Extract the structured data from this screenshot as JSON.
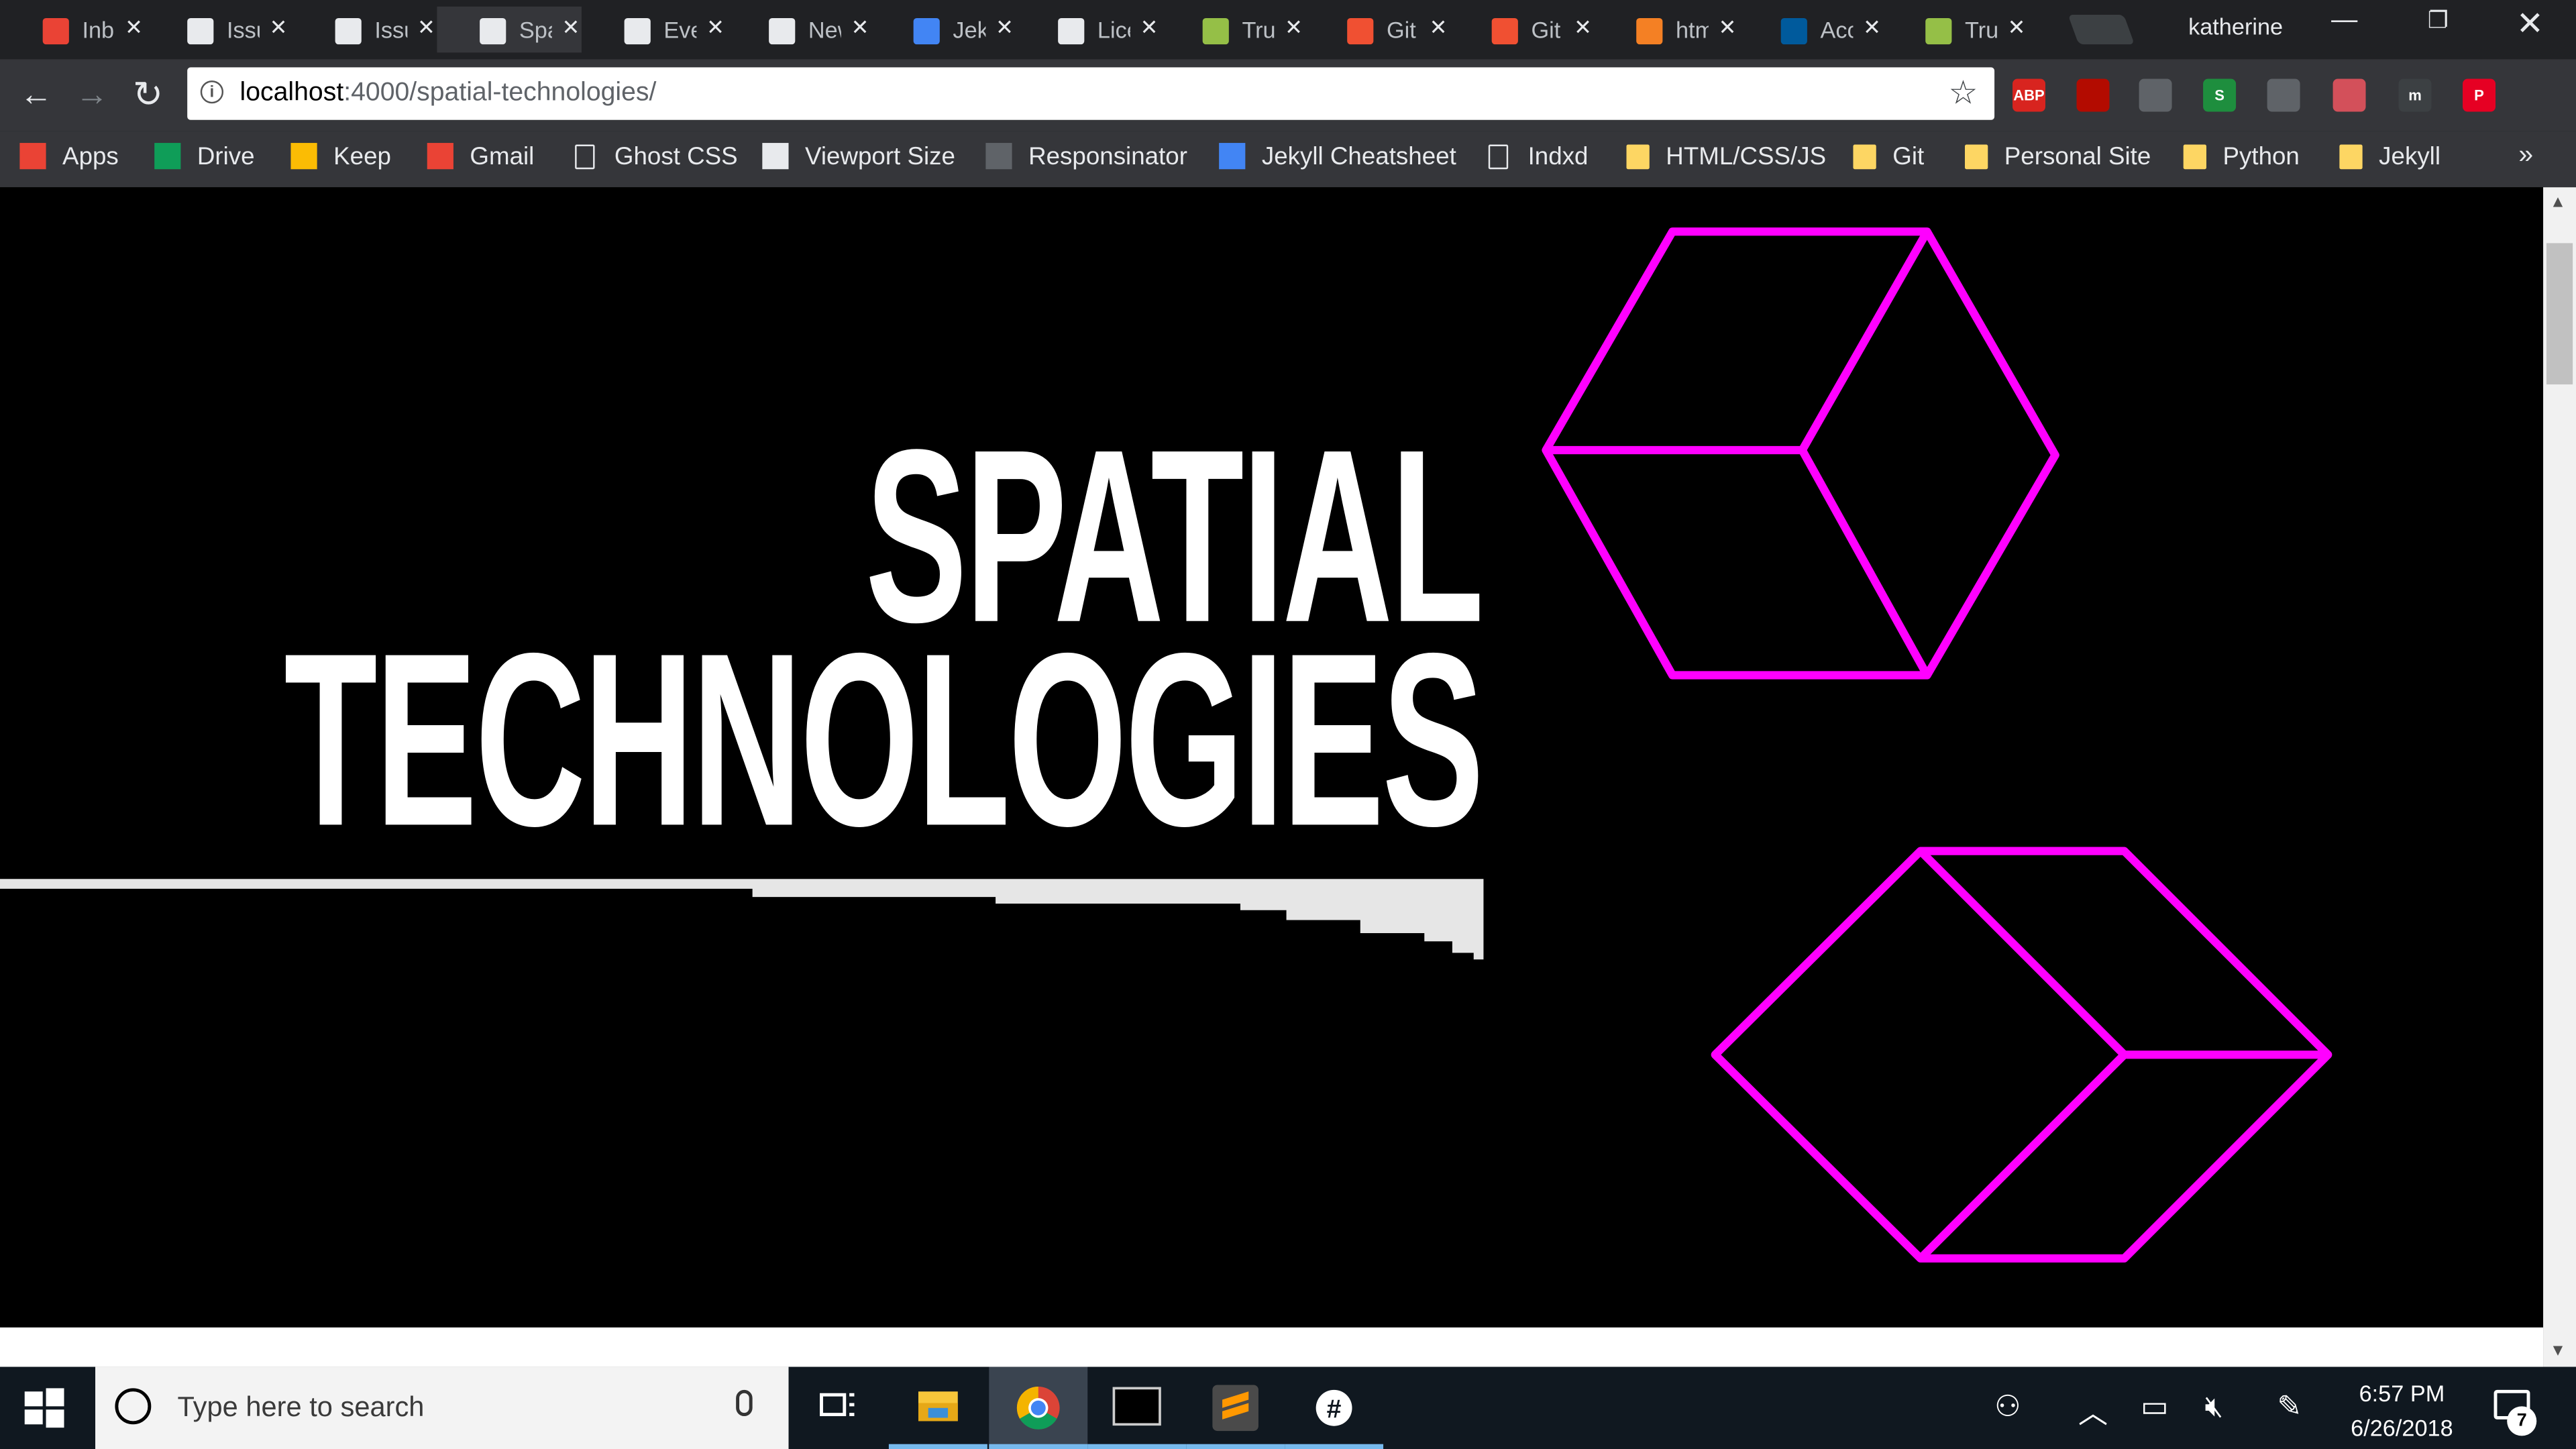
{
  "browser": {
    "tabs": [
      {
        "title": "Inbox",
        "icon": "gmail-icon",
        "color": "#ea4335"
      },
      {
        "title": "Issues",
        "icon": "github-icon",
        "color": "#e8eaed"
      },
      {
        "title": "Issues",
        "icon": "github-icon",
        "color": "#e8eaed"
      },
      {
        "title": "Spatial",
        "icon": "page-icon",
        "color": "#e8eaed",
        "active": true
      },
      {
        "title": "Events",
        "icon": "page-icon",
        "color": "#e8eaed"
      },
      {
        "title": "New",
        "icon": "page-icon",
        "color": "#e8eaed"
      },
      {
        "title": "Jekyll",
        "icon": "code-icon",
        "color": "#4285f4"
      },
      {
        "title": "License",
        "icon": "github-icon",
        "color": "#e8eaed"
      },
      {
        "title": "Trust",
        "icon": "shopify-icon",
        "color": "#95bf47"
      },
      {
        "title": "Git",
        "icon": "git-icon",
        "color": "#f05032"
      },
      {
        "title": "Git",
        "icon": "git-icon",
        "color": "#f05032"
      },
      {
        "title": "html",
        "icon": "stackoverflow-icon",
        "color": "#f48024"
      },
      {
        "title": "Accessibility",
        "icon": "w3-icon",
        "color": "#005a9c"
      },
      {
        "title": "Trust",
        "icon": "shopify-icon",
        "color": "#95bf47"
      }
    ],
    "profile_name": "katherine",
    "url_host": "localhost",
    "url_path": ":4000/spatial-technologies/",
    "extensions": [
      {
        "name": "adblock-plus-icon",
        "label": "ABP",
        "color": "#d8241f"
      },
      {
        "name": "acrobat-icon",
        "label": "",
        "color": "#b30b00"
      },
      {
        "name": "search-extension-icon",
        "label": "",
        "color": "#5f6368"
      },
      {
        "name": "s-extension-icon",
        "label": "S",
        "color": "#1e8e3e"
      },
      {
        "name": "bulb-extension-icon",
        "label": "",
        "color": "#5f6368"
      },
      {
        "name": "pocket-icon",
        "label": "",
        "color": "#d3505a"
      },
      {
        "name": "m-extension-icon",
        "label": "m",
        "color": "#3c4043"
      },
      {
        "name": "pinterest-icon",
        "label": "P",
        "color": "#e60023"
      }
    ],
    "bookmarks": [
      {
        "label": "Apps",
        "icon": "apps-grid-icon"
      },
      {
        "label": "Drive",
        "icon": "drive-icon"
      },
      {
        "label": "Keep",
        "icon": "keep-icon"
      },
      {
        "label": "Gmail",
        "icon": "gmail-icon"
      },
      {
        "label": "Ghost CSS",
        "icon": "page-icon"
      },
      {
        "label": "Viewport Size",
        "icon": "viewport-icon"
      },
      {
        "label": "Responsinator",
        "icon": "responsinator-icon"
      },
      {
        "label": "Jekyll Cheatsheet",
        "icon": "code-icon"
      },
      {
        "label": "Indxd",
        "icon": "page-icon"
      },
      {
        "label": "HTML/CSS/JS",
        "icon": "folder-icon"
      },
      {
        "label": "Git",
        "icon": "folder-icon"
      },
      {
        "label": "Personal Site",
        "icon": "folder-icon"
      },
      {
        "label": "Python",
        "icon": "folder-icon"
      },
      {
        "label": "Jekyll",
        "icon": "folder-icon"
      }
    ],
    "bookmarks_overflow": "»"
  },
  "page": {
    "title_line1": "SPATIAL",
    "title_line2": "TECHNOLOGIES",
    "accent_color": "#ff00ff",
    "background_color": "#000000"
  },
  "taskbar": {
    "search_placeholder": "Type here to search",
    "time": "6:57 PM",
    "date": "6/26/2018",
    "notification_count": "7",
    "apps": [
      "task-view-icon",
      "file-explorer-icon",
      "chrome-icon",
      "terminal-icon",
      "sublime-icon",
      "slack-icon"
    ]
  }
}
